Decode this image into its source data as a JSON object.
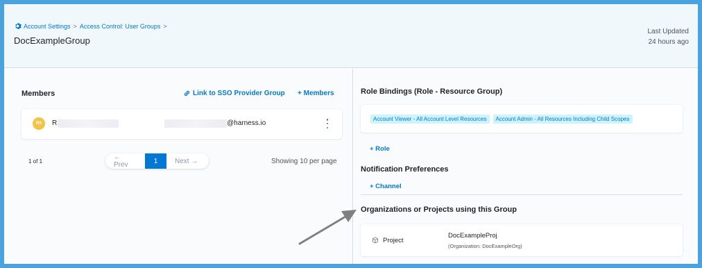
{
  "header": {
    "breadcrumb": [
      "Account Settings",
      "Access Control: User Groups"
    ],
    "title": "DocExampleGroup",
    "last_updated_label": "Last Updated",
    "last_updated_value": "24 hours ago"
  },
  "members": {
    "title": "Members",
    "link_sso_label": "Link to SSO Provider Group",
    "add_members_label": "+ Members",
    "rows": [
      {
        "avatar_initials": "RS",
        "name": "R",
        "email": "@harness.io"
      }
    ],
    "page_count": "1 of 1",
    "pagination": {
      "prev_label": "← Prev",
      "current_page": "1",
      "next_label": "Next →"
    },
    "showing_label": "Showing 10 per page"
  },
  "role_bindings": {
    "title": "Role Bindings (Role - Resource Group)",
    "tags": [
      "Account Viewer - All Account Level Resources",
      "Account Admin - All Resources Including Child Scopes"
    ],
    "add_role_label": "+ Role"
  },
  "notification_preferences": {
    "title": "Notification Preferences",
    "add_channel_label": "+ Channel"
  },
  "organizations_projects": {
    "title": "Organizations or Projects using this Group",
    "type_label": "Project",
    "project_name": "DocExampleProj",
    "org_label": "(Organization: DocExampleOrg)"
  },
  "colors": {
    "frame_border": "#4aa3df",
    "accent": "#0278d5",
    "tag_bg": "#cdf4fe",
    "avatar_bg": "#f5c342",
    "arrow": "#808080"
  },
  "icons": [
    "gear-icon",
    "link-icon",
    "more-options-icon",
    "cube-icon",
    "annotation-arrow"
  ]
}
